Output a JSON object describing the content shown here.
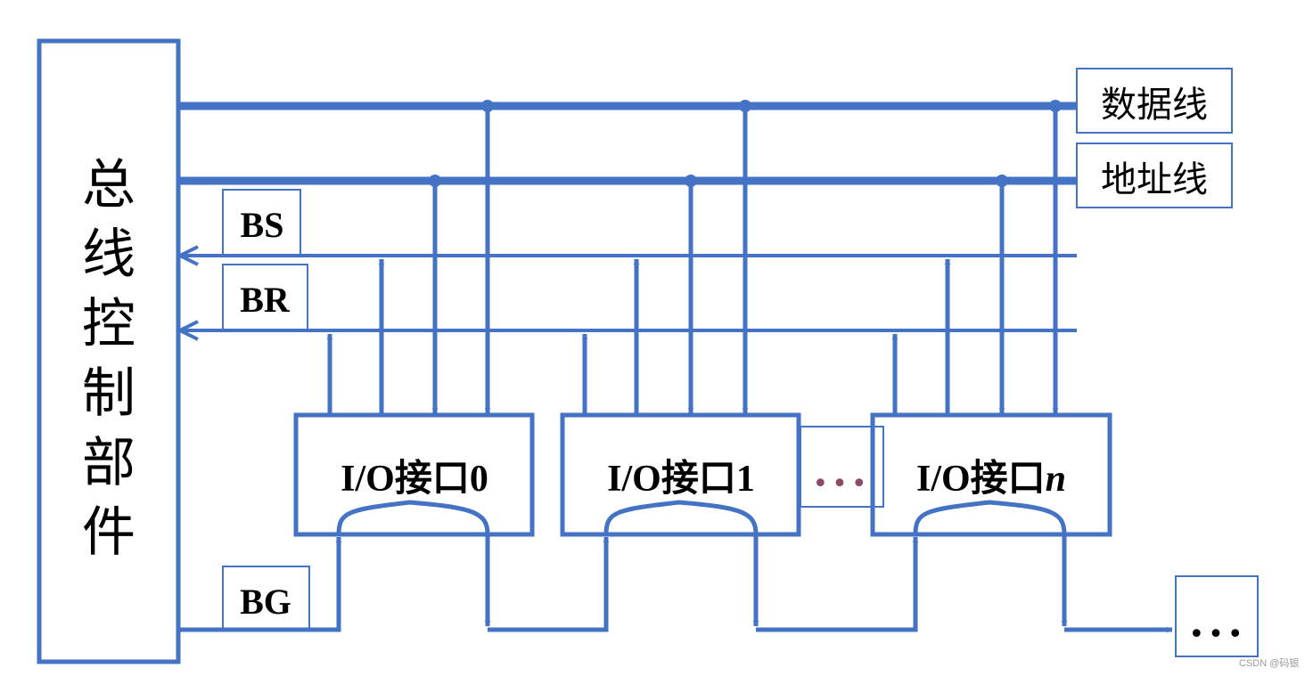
{
  "controller": {
    "label": "总线控制部件"
  },
  "buses": {
    "data_line": "数据线",
    "address_line": "地址线",
    "bs": "BS",
    "br": "BR",
    "bg": "BG"
  },
  "interfaces": [
    {
      "prefix": "I/O接口",
      "index": "0"
    },
    {
      "prefix": "I/O接口",
      "index": "1"
    },
    {
      "prefix": "I/O接口",
      "index": "n"
    }
  ],
  "ellipsis_between": "•••",
  "ellipsis_end": "•••",
  "watermark": "CSDN @码银",
  "colors": {
    "line": "#4472C4",
    "dots_between": "#8B4A6B",
    "text": "#000000"
  }
}
